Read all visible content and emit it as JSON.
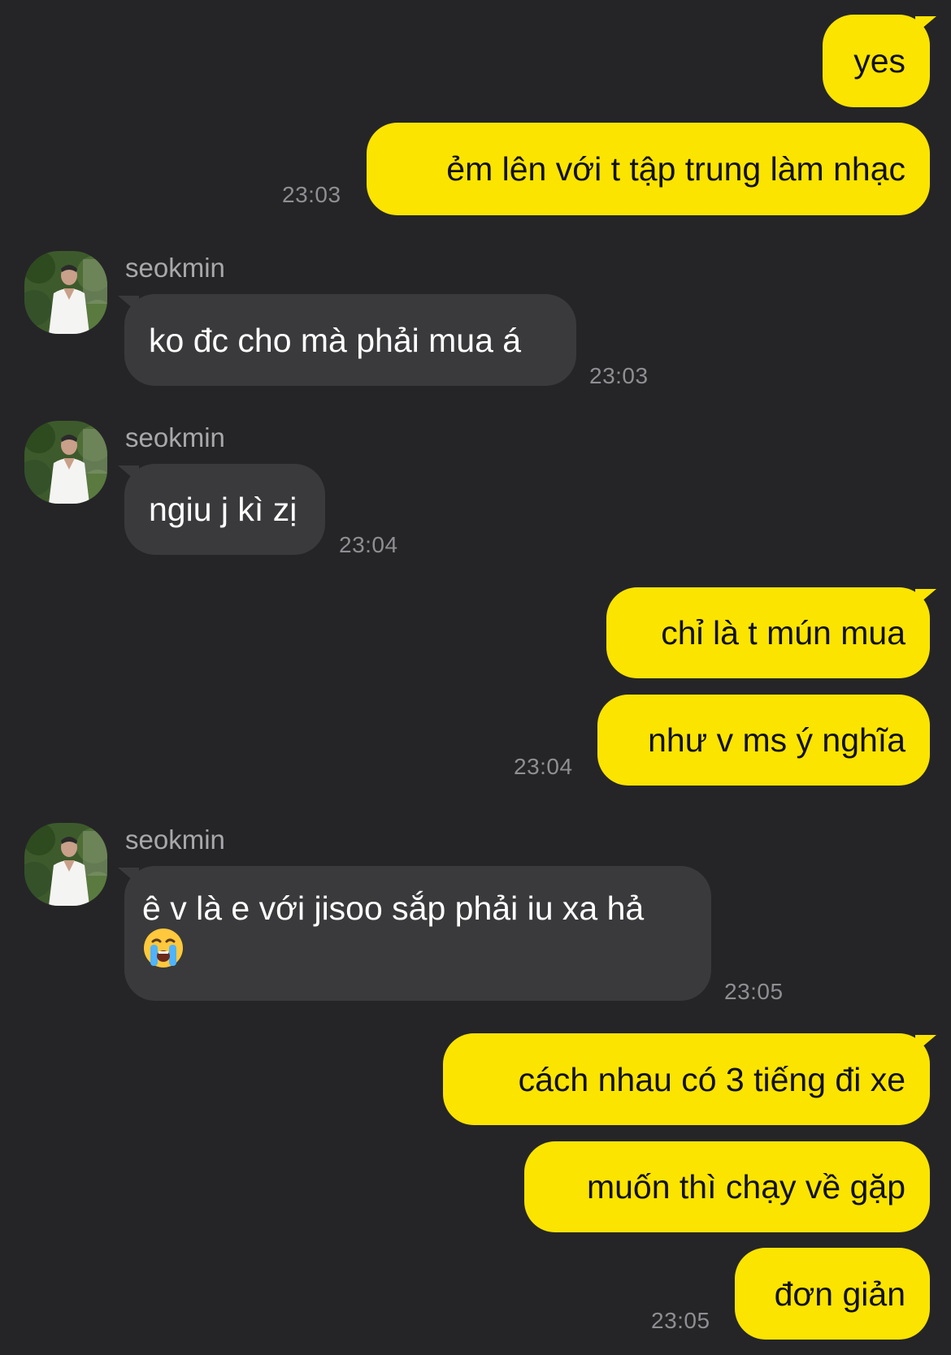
{
  "contact": {
    "name": "seokmin",
    "avatar_icon": "profile-photo"
  },
  "colors": {
    "background": "#252527",
    "outgoing_bubble": "#fbe400",
    "incoming_bubble": "#3a3a3c",
    "timestamp": "#8e8e93"
  },
  "messages": [
    {
      "direction": "out",
      "text": "yes"
    },
    {
      "direction": "out",
      "text": "ẻm lên với t tập trung làm nhạc",
      "time": "23:03"
    },
    {
      "direction": "in",
      "sender": "seokmin",
      "text": "ko đc cho mà phải mua á",
      "time": "23:03"
    },
    {
      "direction": "in",
      "sender": "seokmin",
      "text": "ngiu j kì zị",
      "time": "23:04"
    },
    {
      "direction": "out",
      "text": "chỉ là t mún mua"
    },
    {
      "direction": "out",
      "text": "như v ms ý nghĩa",
      "time": "23:04"
    },
    {
      "direction": "in",
      "sender": "seokmin",
      "text": "ê v là e với jisoo sắp phải iu xa hả",
      "emoji": "😭",
      "emoji_name": "loudly-crying-face",
      "time": "23:05"
    },
    {
      "direction": "out",
      "text": "cách nhau có 3 tiếng đi xe"
    },
    {
      "direction": "out",
      "text": "muốn thì chạy về gặp"
    },
    {
      "direction": "out",
      "text": "đơn giản",
      "time": "23:05"
    }
  ]
}
